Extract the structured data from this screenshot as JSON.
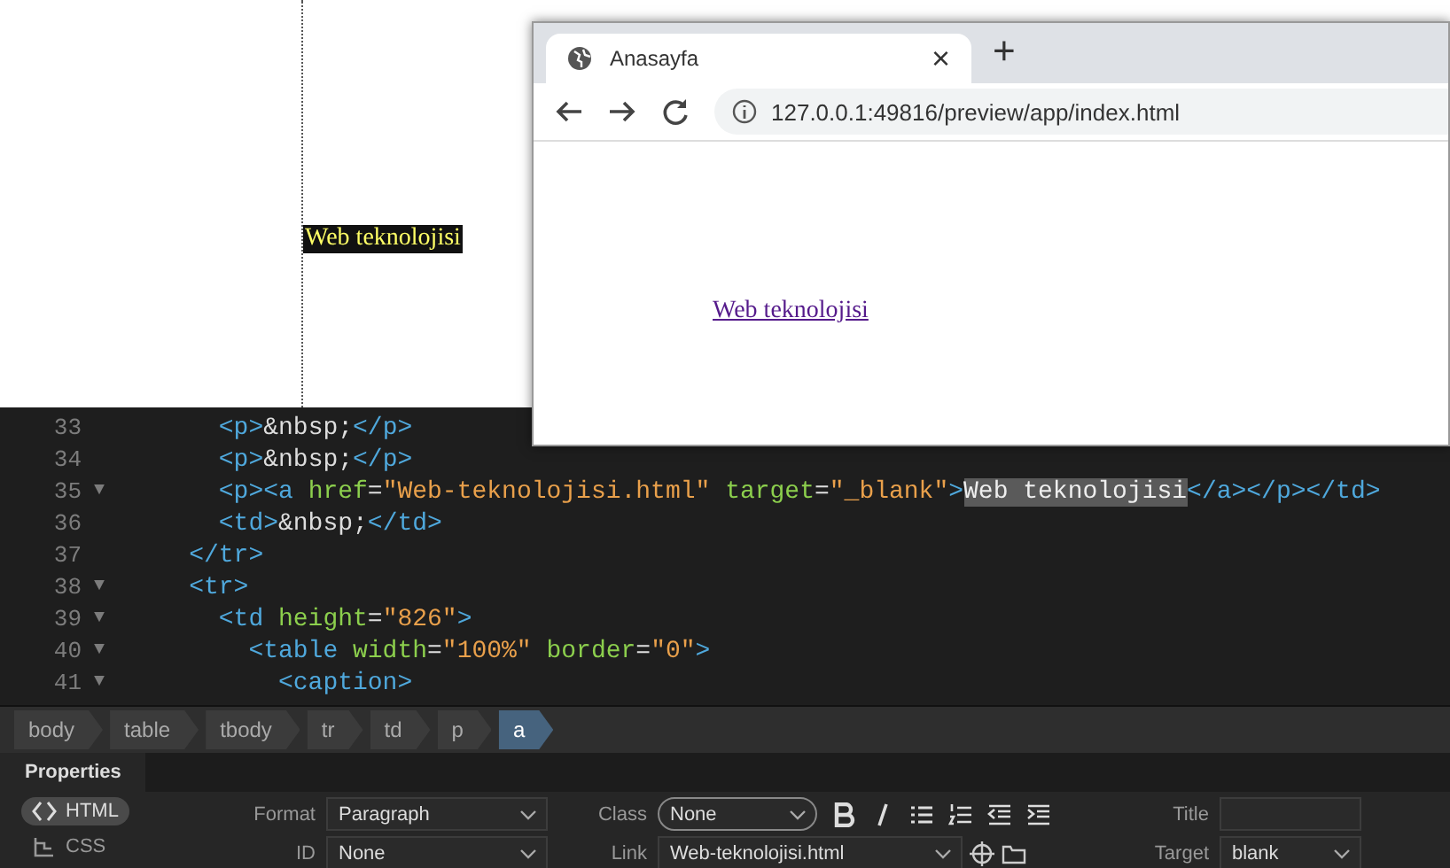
{
  "design_view": {
    "selected_text": "Web teknolojisi"
  },
  "code": [
    {
      "children": [
        {
          "number": "33",
          "tokens": [
            {
              "kind": "tag",
              "text": "<p>"
            },
            {
              "kind": "text",
              "text": "&nbsp;"
            },
            {
              "kind": "tag",
              "text": "</p>"
            }
          ]
        },
        {
          "number": "34",
          "tokens": [
            {
              "kind": "tag",
              "text": "<p>"
            },
            {
              "kind": "text",
              "text": "&nbsp;"
            },
            {
              "kind": "tag",
              "text": "</p>"
            }
          ]
        },
        {
          "number": "35",
          "fold_marker": "▼",
          "tokens": [
            {
              "kind": "tag",
              "text": "<p><a "
            },
            {
              "kind": "attr",
              "text": "href"
            },
            {
              "kind": "text",
              "text": "="
            },
            {
              "kind": "string",
              "text": "\"Web-teknolojisi.html\""
            },
            {
              "kind": "attr",
              "text": " target"
            },
            {
              "kind": "text",
              "text": "="
            },
            {
              "kind": "string",
              "text": "\"_blank\""
            },
            {
              "kind": "tag",
              "text": ">"
            },
            {
              "kind": "selected",
              "text": "Web teknolojisi"
            },
            {
              "kind": "tag",
              "text": "</a></p></td>"
            }
          ]
        },
        {
          "number": "36",
          "tokens": [
            {
              "kind": "tag",
              "text": "<td>"
            },
            {
              "kind": "text",
              "text": "&nbsp;"
            },
            {
              "kind": "tag",
              "text": "</td>"
            }
          ]
        }
      ]
    },
    {
      "number": "37",
      "tokens": [
        {
          "kind": "tag",
          "text": "</tr>"
        }
      ]
    },
    {
      "number": "38",
      "fold_marker": "▼",
      "tokens": [
        {
          "kind": "tag",
          "text": "<tr>"
        }
      ],
      "children": [
        {
          "number": "39",
          "fold_marker": "▼",
          "tokens": [
            {
              "kind": "tag",
              "text": "<td "
            },
            {
              "kind": "attr",
              "text": "height"
            },
            {
              "kind": "text",
              "text": "="
            },
            {
              "kind": "string",
              "text": "\"826\""
            },
            {
              "kind": "tag",
              "text": ">"
            }
          ],
          "children": [
            {
              "number": "40",
              "fold_marker": "▼",
              "tokens": [
                {
                  "kind": "tag",
                  "text": "<table "
                },
                {
                  "kind": "attr",
                  "text": "width"
                },
                {
                  "kind": "text",
                  "text": "="
                },
                {
                  "kind": "string",
                  "text": "\"100%\""
                },
                {
                  "kind": "attr",
                  "text": " border"
                },
                {
                  "kind": "text",
                  "text": "="
                },
                {
                  "kind": "string",
                  "text": "\"0\""
                },
                {
                  "kind": "tag",
                  "text": ">"
                }
              ],
              "children": [
                {
                  "number": "41",
                  "fold_marker": "▼",
                  "tokens": [
                    {
                      "kind": "tag",
                      "text": "<caption>"
                    }
                  ]
                }
              ]
            }
          ]
        }
      ]
    }
  ],
  "breadcrumbs": [
    {
      "label": "body",
      "selected": false
    },
    {
      "label": "table",
      "selected": false
    },
    {
      "label": "tbody",
      "selected": false
    },
    {
      "label": "tr",
      "selected": false
    },
    {
      "label": "td",
      "selected": false
    },
    {
      "label": "p",
      "selected": false
    },
    {
      "label": "a",
      "selected": true
    }
  ],
  "properties": {
    "title": "Properties",
    "modes": [
      {
        "label": "HTML",
        "selected": true
      },
      {
        "label": "CSS",
        "selected": false
      }
    ],
    "format": {
      "label": "Format",
      "value": "Paragraph"
    },
    "id": {
      "label": "ID",
      "value": "None"
    },
    "class": {
      "label": "Class",
      "value": "None"
    },
    "link": {
      "label": "Link",
      "value": "Web-teknolojisi.html"
    },
    "title_field": {
      "label": "Title"
    },
    "target": {
      "label": "Target",
      "value": "blank"
    }
  },
  "browser": {
    "tab_title": "Anasayfa",
    "close": "×",
    "new_tab": "+",
    "url": "127.0.0.1:49816/preview/app/index.html",
    "link": "Web teknolojisi"
  }
}
